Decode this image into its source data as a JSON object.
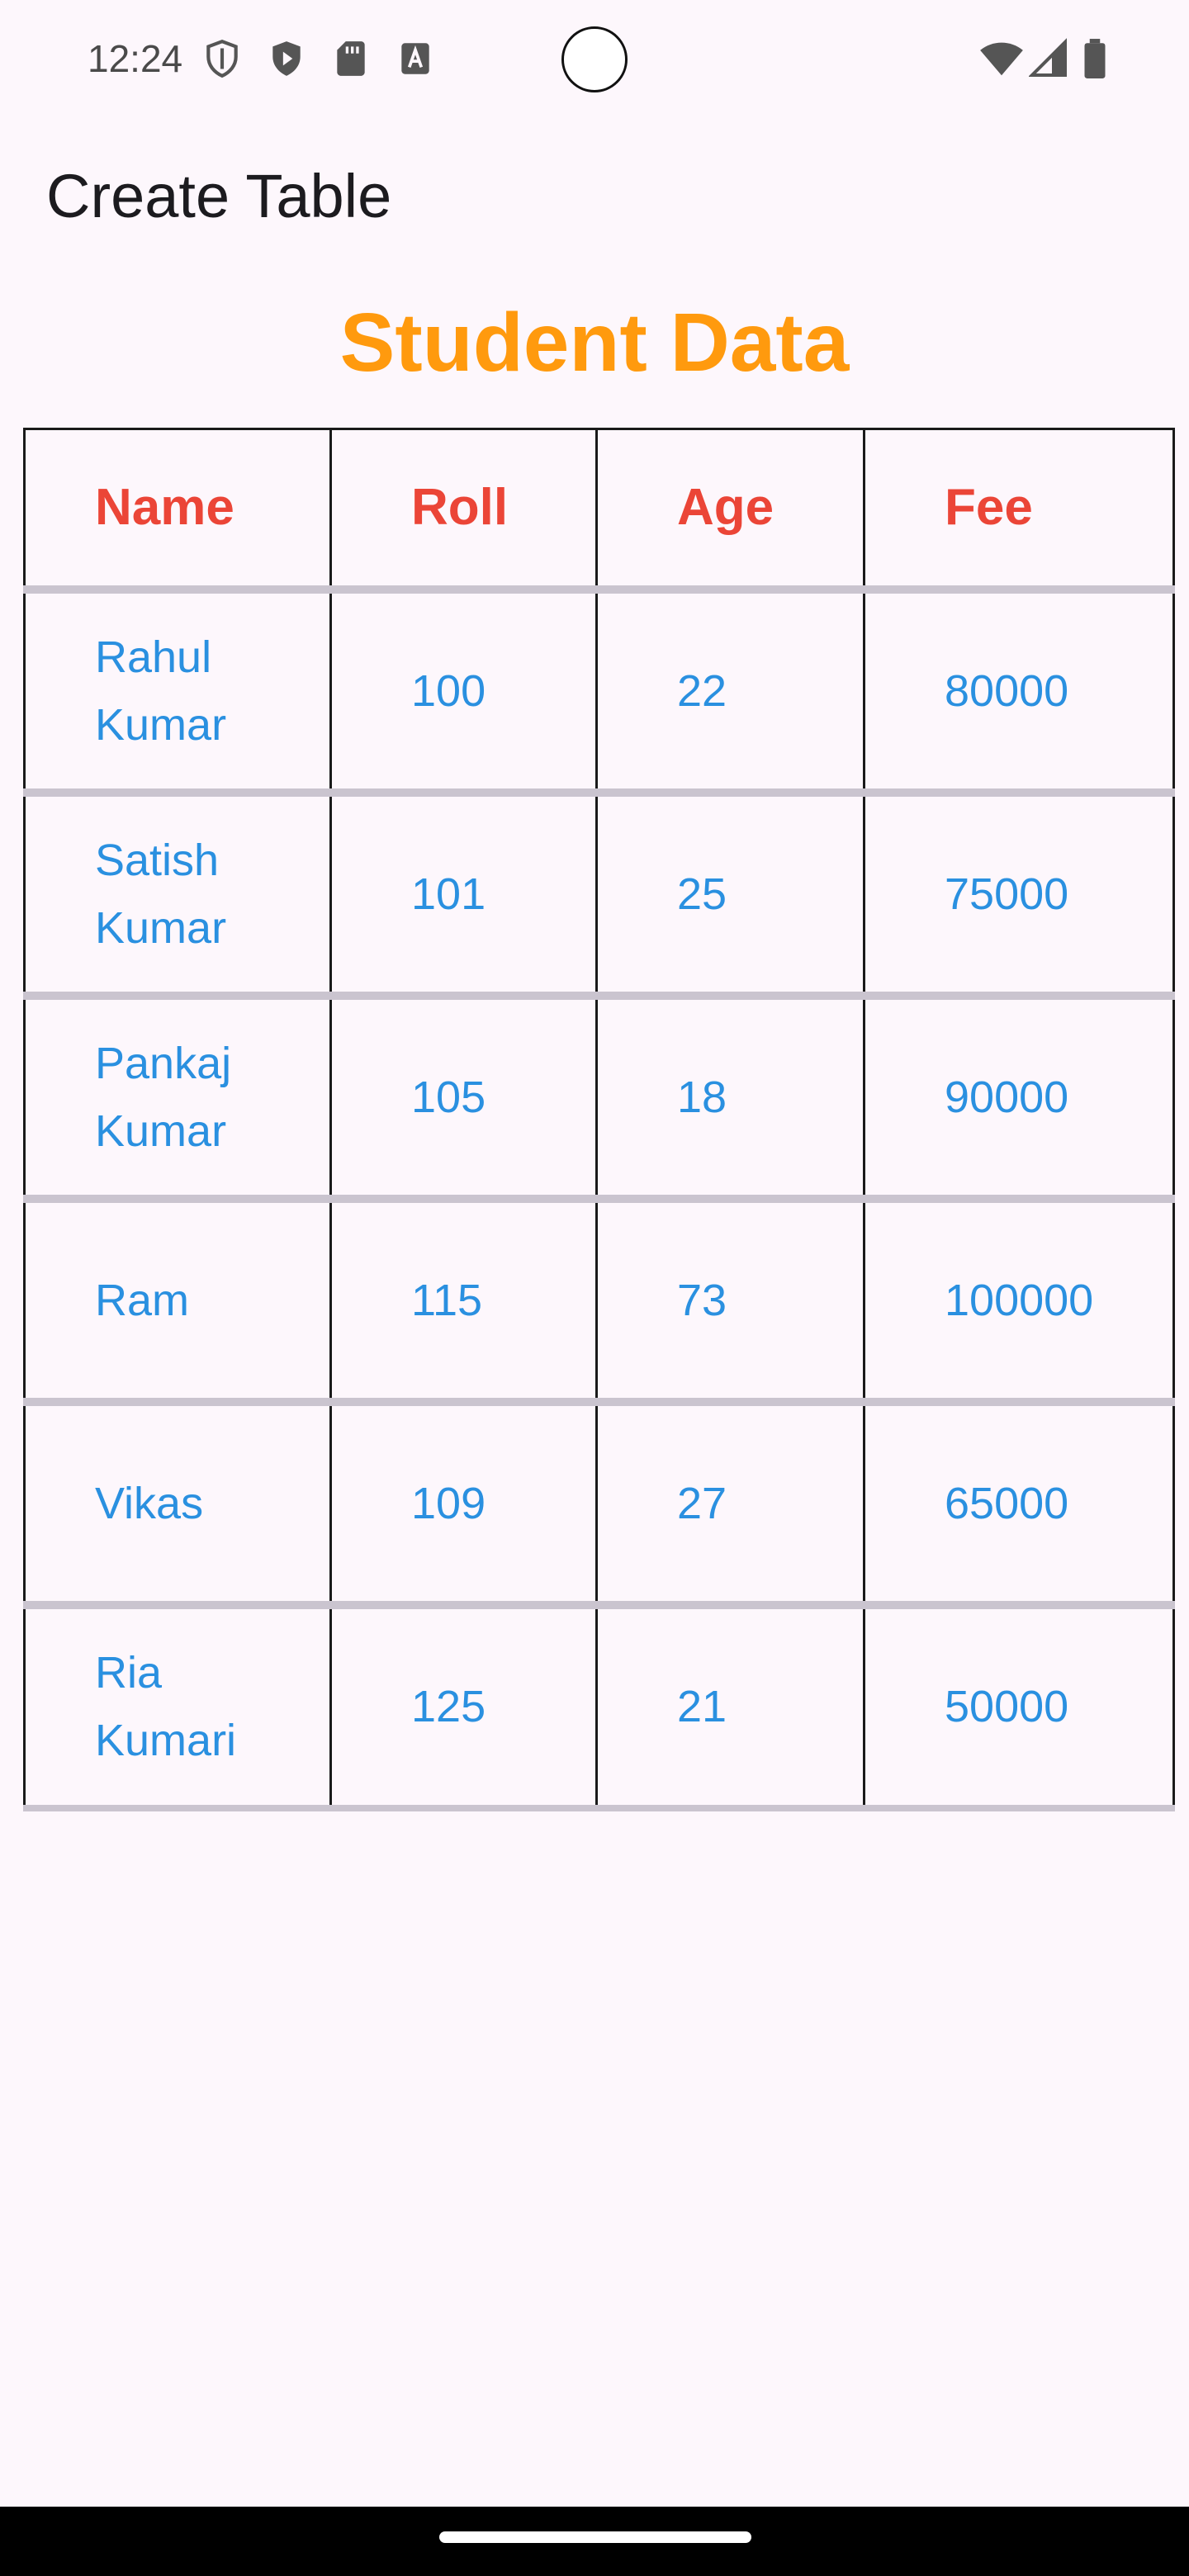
{
  "status_bar": {
    "time": "12:24",
    "left_icons": [
      "shield-outline-icon",
      "play-shield-icon",
      "sd-card-icon",
      "font-a-icon"
    ],
    "right_icons": [
      "wifi-icon",
      "cellular-signal-icon",
      "battery-icon"
    ]
  },
  "app_bar": {
    "title": "Create Table"
  },
  "heading": {
    "text": "Student Data",
    "color": "#FF9A0E"
  },
  "table": {
    "header_color": "#EB4537",
    "cell_color": "#2A90E0",
    "columns": [
      "Name",
      "Roll",
      "Age",
      "Fee"
    ],
    "rows": [
      {
        "name": "Rahul Kumar",
        "roll": "100",
        "age": "22",
        "fee": "80000"
      },
      {
        "name": "Satish Kumar",
        "roll": "101",
        "age": "25",
        "fee": "75000"
      },
      {
        "name": "Pankaj Kumar",
        "roll": "105",
        "age": "18",
        "fee": "90000"
      },
      {
        "name": "Ram",
        "roll": "115",
        "age": "73",
        "fee": "100000"
      },
      {
        "name": "Vikas",
        "roll": "109",
        "age": "27",
        "fee": "65000"
      },
      {
        "name": "Ria Kumari",
        "roll": "125",
        "age": "21",
        "fee": "50000"
      }
    ]
  },
  "background_color": "#FDF7FC"
}
